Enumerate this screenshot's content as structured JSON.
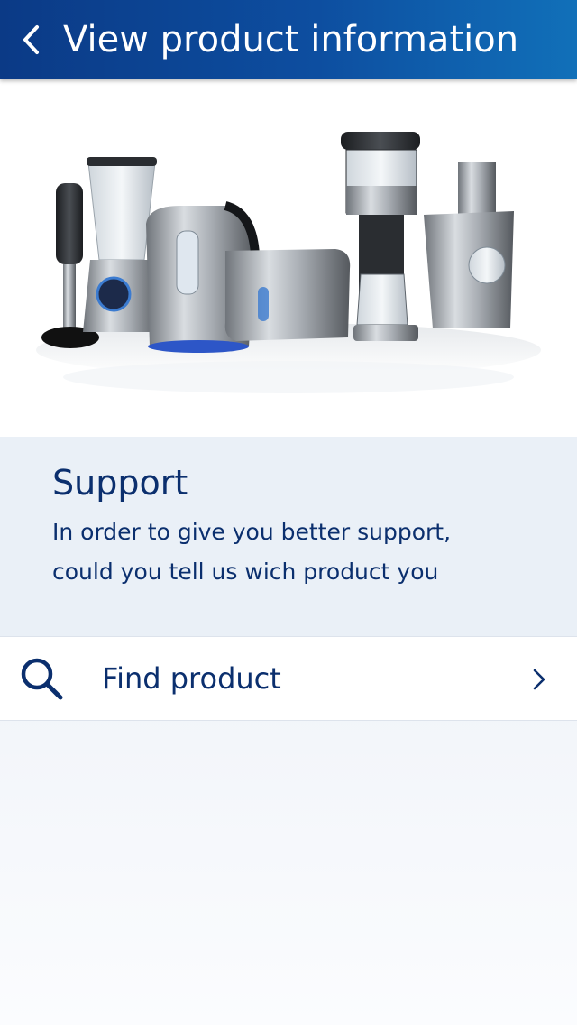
{
  "header": {
    "title": "View product information",
    "back_icon": "chevron-left-icon"
  },
  "hero": {
    "image": "philips-appliances-photo"
  },
  "support": {
    "title": "Support",
    "line1": "In order to give you better support,",
    "line2": "could you tell us wich product you"
  },
  "find_product": {
    "label": "Find product",
    "icon": "search-icon",
    "chevron": "chevron-right-icon"
  },
  "colors": {
    "header_start": "#0b3a86",
    "header_end": "#1170b9",
    "text_primary": "#0b2f6e",
    "support_bg": "#eaf0f7"
  }
}
